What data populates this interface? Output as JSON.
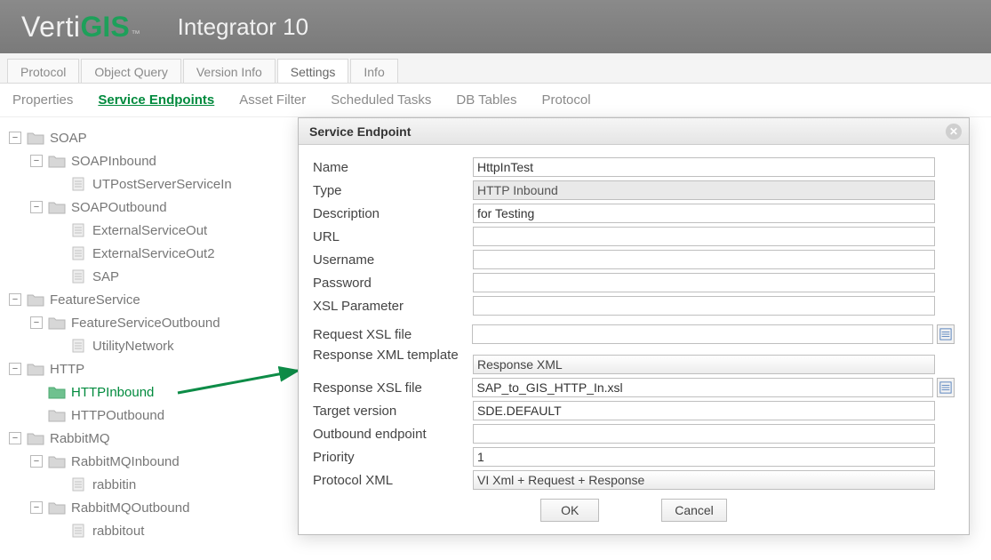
{
  "logo": {
    "part1": "Verti",
    "part2": "GIS",
    "tm": "™"
  },
  "appTitle": "Integrator 10",
  "mainTabs": [
    "Protocol",
    "Object Query",
    "Version Info",
    "Settings",
    "Info"
  ],
  "mainTabActive": 3,
  "subTabs": [
    "Properties",
    "Service Endpoints",
    "Asset Filter",
    "Scheduled Tasks",
    "DB Tables",
    "Protocol"
  ],
  "subTabActive": 1,
  "tree": [
    {
      "label": "SOAP",
      "type": "folder",
      "indent": 0,
      "exp": "minus"
    },
    {
      "label": "SOAPInbound",
      "type": "folder",
      "indent": 1,
      "exp": "minus"
    },
    {
      "label": "UTPostServerServiceIn",
      "type": "file",
      "indent": 2
    },
    {
      "label": "SOAPOutbound",
      "type": "folder",
      "indent": 1,
      "exp": "minus"
    },
    {
      "label": "ExternalServiceOut",
      "type": "file",
      "indent": 2
    },
    {
      "label": "ExternalServiceOut2",
      "type": "file",
      "indent": 2
    },
    {
      "label": "SAP",
      "type": "file",
      "indent": 2
    },
    {
      "label": "FeatureService",
      "type": "folder",
      "indent": 0,
      "exp": "minus"
    },
    {
      "label": "FeatureServiceOutbound",
      "type": "folder",
      "indent": 1,
      "exp": "minus"
    },
    {
      "label": "UtilityNetwork",
      "type": "file",
      "indent": 2
    },
    {
      "label": "HTTP",
      "type": "folder",
      "indent": 0,
      "exp": "minus"
    },
    {
      "label": "HTTPInbound",
      "type": "folder",
      "indent": 1,
      "selected": true
    },
    {
      "label": "HTTPOutbound",
      "type": "folder",
      "indent": 1
    },
    {
      "label": "RabbitMQ",
      "type": "folder",
      "indent": 0,
      "exp": "minus"
    },
    {
      "label": "RabbitMQInbound",
      "type": "folder",
      "indent": 1,
      "exp": "minus"
    },
    {
      "label": "rabbitin",
      "type": "file",
      "indent": 2
    },
    {
      "label": "RabbitMQOutbound",
      "type": "folder",
      "indent": 1,
      "exp": "minus"
    },
    {
      "label": "rabbitout",
      "type": "file",
      "indent": 2
    }
  ],
  "dialog": {
    "title": "Service Endpoint",
    "fields": {
      "name_label": "Name",
      "name_value": "HttpInTest",
      "type_label": "Type",
      "type_value": "HTTP Inbound",
      "desc_label": "Description",
      "desc_value": "for Testing",
      "url_label": "URL",
      "url_value": "",
      "user_label": "Username",
      "user_value": "",
      "pass_label": "Password",
      "pass_value": "",
      "xslparam_label": "XSL Parameter",
      "xslparam_value": "",
      "reqxsl_label": "Request XSL file",
      "reqxsl_value": "",
      "resxml_label": "Response XML template",
      "resxml_value": "Response XML",
      "resxsl_label": "Response XSL file",
      "resxsl_value": "SAP_to_GIS_HTTP_In.xsl",
      "target_label": "Target version",
      "target_value": "SDE.DEFAULT",
      "outbound_label": "Outbound endpoint",
      "outbound_value": "",
      "priority_label": "Priority",
      "priority_value": "1",
      "protocol_label": "Protocol XML",
      "protocol_value": "VI Xml + Request + Response"
    },
    "buttons": {
      "ok": "OK",
      "cancel": "Cancel"
    }
  }
}
